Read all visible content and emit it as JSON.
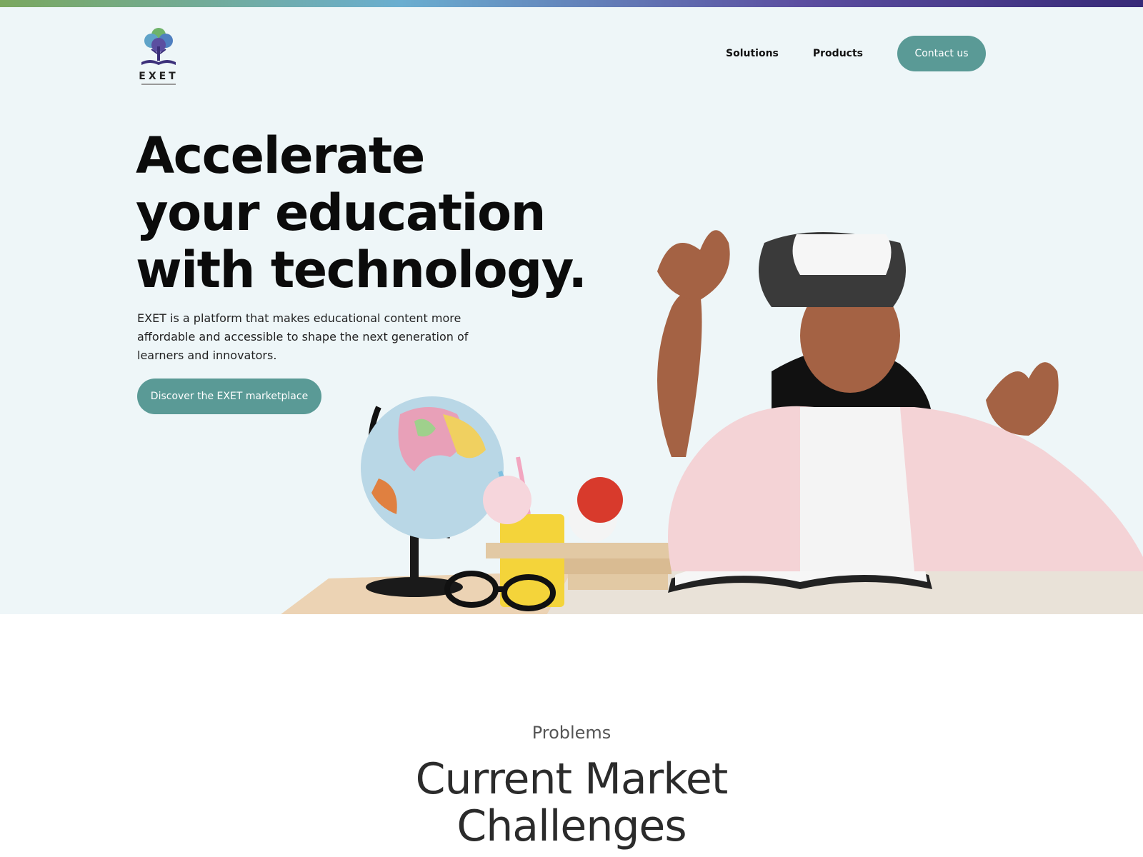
{
  "brand": {
    "name": "EXET"
  },
  "nav": {
    "items": [
      {
        "label": "Solutions"
      },
      {
        "label": "Products"
      }
    ],
    "contact_label": "Contact us"
  },
  "hero": {
    "headline_lines": [
      "Accelerate",
      "your education",
      "with technology."
    ],
    "description": "EXET is a platform that makes educational content more affordable and accessible to shape the next generation of learners and innovators.",
    "cta_label": "Discover the EXET marketplace",
    "image_icon": "girl-with-vr-headset-and-desk-illustration"
  },
  "problems": {
    "eyebrow": "Problems",
    "title_lines": [
      "Current Market",
      "Challenges"
    ]
  },
  "colors": {
    "accent": "#5a9a96",
    "hero_background": "#eef6f8",
    "text": "#0b0b0b"
  }
}
